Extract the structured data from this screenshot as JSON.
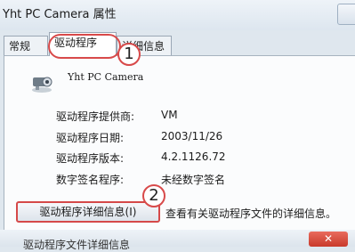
{
  "window": {
    "title": "Yht PC Camera 属性"
  },
  "tabs": [
    {
      "label": "常规"
    },
    {
      "label": "驱动程序"
    },
    {
      "label": "详细信息"
    }
  ],
  "device": {
    "name": "Yht PC Camera",
    "icon": "camera-icon"
  },
  "driver_info": [
    {
      "label": "驱动程序提供商:",
      "value": "VM"
    },
    {
      "label": "驱动程序日期:",
      "value": "2003/11/26"
    },
    {
      "label": "驱动程序版本:",
      "value": "4.2.1126.72"
    },
    {
      "label": "数字签名程序:",
      "value": "未经数字签名"
    }
  ],
  "actions": {
    "driver_details_button": "驱动程序详细信息(I)",
    "driver_details_description": "查看有关驱动程序文件的详细信息。"
  },
  "annotations": {
    "step1": "1",
    "step2": "2"
  },
  "subwindow": {
    "title": "驱动程序文件详细信息",
    "close_label": "✕"
  },
  "colors": {
    "annotation_red": "#d84a4a",
    "close_button_red": "#c83a2b"
  }
}
